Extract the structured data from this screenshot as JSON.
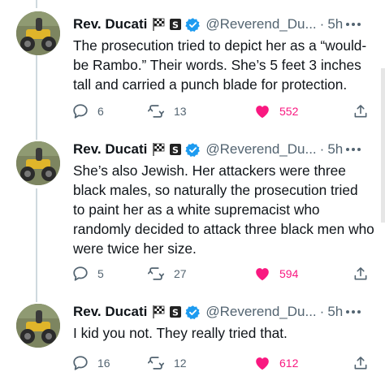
{
  "tweets": [
    {
      "name": "Rev. Ducati",
      "handle": "@Reverend_Du...",
      "dot": "·",
      "time": "5h",
      "text_lines": [
        "The prosecution tried to depict her as a “would-",
        "be Rambo.”  Their words.  She’s 5 feet 3 inches",
        "tall and carried a punch blade for protection."
      ],
      "replies": "6",
      "retweets": "13",
      "likes": "552"
    },
    {
      "name": "Rev. Ducati",
      "handle": "@Reverend_Du...",
      "dot": "·",
      "time": "5h",
      "text_lines": [
        "She’s also Jewish.  Her attackers were three",
        "black males, so naturally the prosecution tried",
        "to paint her as a white supremacist who",
        "randomly decided to attack three black men who",
        "were twice her size."
      ],
      "replies": "5",
      "retweets": "27",
      "likes": "594"
    },
    {
      "name": "Rev. Ducati",
      "handle": "@Reverend_Du...",
      "dot": "·",
      "time": "5h",
      "text_lines": [
        "I kid you not.  They really tried that."
      ],
      "replies": "16",
      "retweets": "12",
      "likes": "612"
    }
  ],
  "icons": {
    "verified": "verified-badge-icon",
    "flag": "checkered-flag-icon",
    "badge": "s-badge-icon",
    "more": "more-options-icon",
    "reply": "reply-icon",
    "retweet": "retweet-icon",
    "like": "heart-icon",
    "share": "share-icon"
  },
  "colors": {
    "verified": "#1d9bf0",
    "like": "#f91880",
    "secondary_text": "#536471",
    "thread_line": "#cfd9de"
  }
}
